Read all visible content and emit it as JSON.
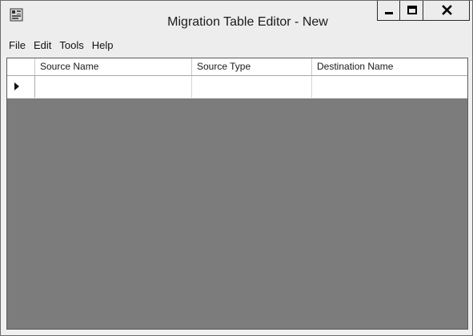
{
  "window": {
    "title": "Migration Table Editor - New",
    "icon": "migration-table-app-icon"
  },
  "title_buttons": [
    "minimize-icon",
    "maximize-icon",
    "close-icon"
  ],
  "menu": {
    "items": [
      {
        "label": "File"
      },
      {
        "label": "Edit"
      },
      {
        "label": "Tools"
      },
      {
        "label": "Help"
      }
    ]
  },
  "grid": {
    "columns": [
      {
        "label": "Source Name"
      },
      {
        "label": "Source Type"
      },
      {
        "label": "Destination Name"
      }
    ],
    "rows": [
      {
        "source_name": "",
        "source_type": "",
        "destination_name": "",
        "row_marker": "current-row-arrow-icon"
      }
    ],
    "colors": {
      "background": "#7c7c7c",
      "cell": "#ffffff"
    }
  }
}
